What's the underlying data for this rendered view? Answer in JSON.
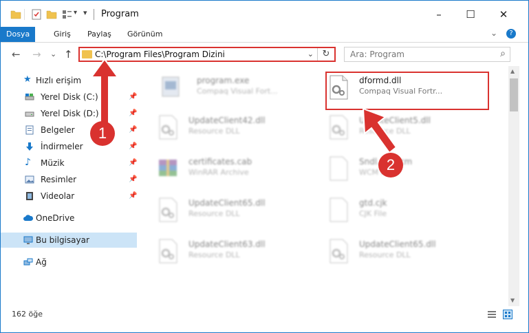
{
  "window": {
    "title": "Program",
    "controls": {
      "minimize": "–",
      "maximize": "☐",
      "close": "✕"
    }
  },
  "ribbon": {
    "tabs": [
      {
        "label": "Dosya",
        "active": true
      },
      {
        "label": "Giriş",
        "active": false
      },
      {
        "label": "Paylaş",
        "active": false
      },
      {
        "label": "Görünüm",
        "active": false
      }
    ],
    "expand_glyph": "⌄",
    "help_glyph": "?"
  },
  "nav": {
    "back": "←",
    "forward": "→",
    "recent": "⌄",
    "up": "↑",
    "address_path": "C:\\Program Files\\Program Dizini",
    "address_dropdown": "⌄",
    "refresh": "↻",
    "search_placeholder": "Ara: Program",
    "search_icon": "⌕"
  },
  "sidebar": {
    "quick_access": "Hızlı erişim",
    "items": [
      {
        "label": "Yerel Disk (C:)",
        "icon": "drive-icon",
        "pinned": true
      },
      {
        "label": "Yerel Disk (D:)",
        "icon": "drive-icon",
        "pinned": true
      },
      {
        "label": "Belgeler",
        "icon": "documents-icon",
        "pinned": true
      },
      {
        "label": "İndirmeler",
        "icon": "downloads-icon",
        "pinned": true
      },
      {
        "label": "Müzik",
        "icon": "music-icon",
        "pinned": true
      },
      {
        "label": "Resimler",
        "icon": "pictures-icon",
        "pinned": true
      },
      {
        "label": "Videolar",
        "icon": "videos-icon",
        "pinned": true
      }
    ],
    "onedrive": "OneDrive",
    "this_pc": "Bu bilgisayar",
    "network": "Ağ",
    "pin_glyph": "📌"
  },
  "files": [
    {
      "name": "program.exe",
      "type": "Compaq Visual Fort...",
      "icon": "exe-icon",
      "blurred": true
    },
    {
      "name": "dformd.dll",
      "type": "Compaq Visual Fortr...",
      "icon": "dll-gear-icon",
      "blurred": false
    },
    {
      "name": "UpdateClient42.dll",
      "type": "Resource DLL",
      "icon": "dll-gear-icon",
      "blurred": true
    },
    {
      "name": "UpdateClient5.dll",
      "type": "Resource DLL",
      "icon": "dll-gear-icon",
      "blurred": true
    },
    {
      "name": "certificates.cab",
      "type": "WinRAR Archive",
      "icon": "archive-icon",
      "blurred": true
    },
    {
      "name": "Sndl...6.wcm",
      "type": "WCM File",
      "icon": "blank-file-icon",
      "blurred": true
    },
    {
      "name": "UpdateClient65.dll",
      "type": "Resource DLL",
      "icon": "dll-gear-icon",
      "blurred": true
    },
    {
      "name": "gtd.cjk",
      "type": "CJK File",
      "icon": "blank-file-icon",
      "blurred": true
    },
    {
      "name": "UpdateClient63.dll",
      "type": "Resource DLL",
      "icon": "dll-gear-icon",
      "blurred": true
    },
    {
      "name": "UpdateClient65.dll",
      "type": "Resource DLL",
      "icon": "dll-gear-icon",
      "blurred": true
    }
  ],
  "status": {
    "count": "162 öğe"
  },
  "annotations": {
    "badge1": "1",
    "badge2": "2"
  },
  "colors": {
    "accent": "#1979ca",
    "highlight": "#d9322f",
    "folder": "#f0c24e"
  }
}
